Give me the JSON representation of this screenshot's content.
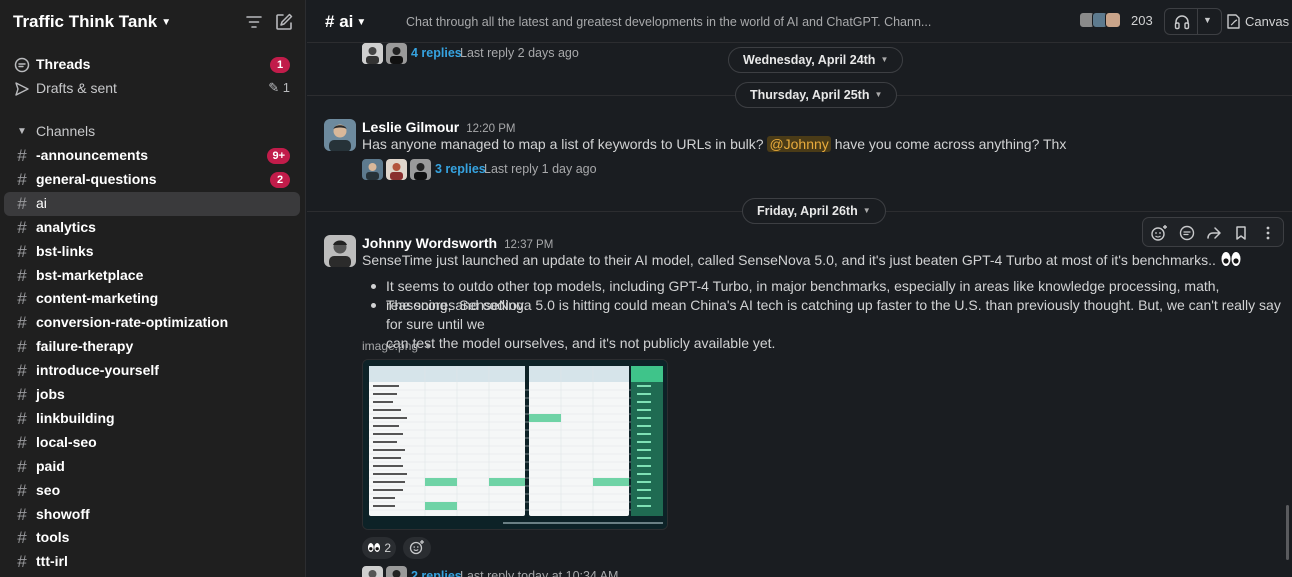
{
  "workspace": {
    "name": "Traffic Think Tank"
  },
  "sidebar": {
    "threads": {
      "label": "Threads",
      "badge": "1"
    },
    "drafts": {
      "label": "Drafts & sent",
      "count": "1"
    },
    "channels_header": "Channels",
    "channels": [
      {
        "name": "-announcements",
        "bold": true,
        "badge": "9+"
      },
      {
        "name": "general-questions",
        "bold": true,
        "badge": "2"
      },
      {
        "name": "ai",
        "bold": false,
        "active": true
      },
      {
        "name": "analytics",
        "bold": true
      },
      {
        "name": "bst-links",
        "bold": true
      },
      {
        "name": "bst-marketplace",
        "bold": true
      },
      {
        "name": "content-marketing",
        "bold": true
      },
      {
        "name": "conversion-rate-optimization",
        "bold": true
      },
      {
        "name": "failure-therapy",
        "bold": true
      },
      {
        "name": "introduce-yourself",
        "bold": true
      },
      {
        "name": "jobs",
        "bold": true
      },
      {
        "name": "linkbuilding",
        "bold": true
      },
      {
        "name": "local-seo",
        "bold": true
      },
      {
        "name": "paid",
        "bold": true
      },
      {
        "name": "seo",
        "bold": true
      },
      {
        "name": "showoff",
        "bold": true
      },
      {
        "name": "tools",
        "bold": true
      },
      {
        "name": "ttt-irl",
        "bold": true
      }
    ]
  },
  "channel_header": {
    "name": "ai",
    "topic": "Chat through all the latest and greatest developments in the world of AI and ChatGPT. Chann...",
    "member_count": "203",
    "canvas_label": "Canvas"
  },
  "messages": {
    "prev_thread": {
      "replies": "4 replies",
      "last_reply": "Last reply 2 days ago"
    },
    "dates": [
      "Wednesday, April 24th",
      "Thursday, April 25th",
      "Friday, April 26th"
    ],
    "leslie": {
      "author": "Leslie Gilmour",
      "time": "12:20 PM",
      "text_before": "Has anyone managed to map a list of keywords to URLs in bulk?",
      "mention": "@Johnny",
      "text_after": "have you come across anything? Thx",
      "replies": "3 replies",
      "last_reply": "Last reply 1 day ago"
    },
    "johnny": {
      "author": "Johnny Wordsworth",
      "time": "12:37 PM",
      "text": "SenseTime just launched an update to their AI model, called SenseNova 5.0, and it's just beaten GPT-4 Turbo at most of it's benchmarks..",
      "bullets": [
        "It seems to outdo other top models, including GPT-4 Turbo, in major benchmarks, especially in areas like knowledge processing, math, reasoning, and coding.",
        "The scores SenseNova 5.0 is hitting could mean China's AI tech is catching up faster to the U.S. than previously thought. But, we can't really say for sure until we",
        "can test the model ourselves, and it's not publicly available yet."
      ],
      "file_name": "image.png",
      "reaction_count": "2",
      "next_replies": "2 replies",
      "next_last_reply": "Last reply today at 10:34 AM"
    }
  },
  "colors": {
    "accent_link": "#36a3e0",
    "badge": "#c11c4a",
    "mention_bg": "#4a3b17",
    "mention_fg": "#e8ab3c"
  }
}
